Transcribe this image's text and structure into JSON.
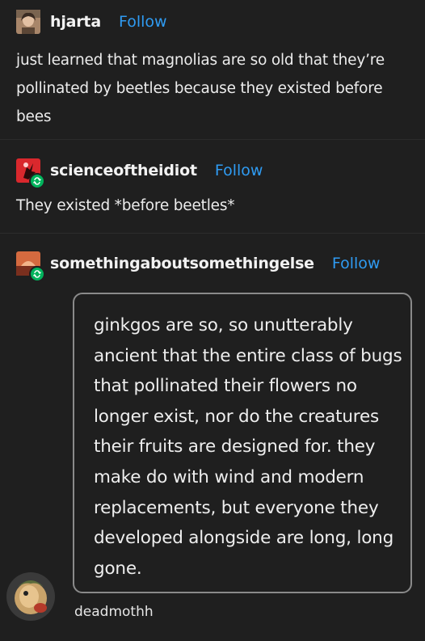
{
  "posts": [
    {
      "username": "hjarta",
      "follow_label": "Follow",
      "text": "just learned that magnolias are so old that they’re pollinated by beetles because they existed before bees"
    },
    {
      "username": "scienceoftheidiot",
      "follow_label": "Follow",
      "text": "They existed *before beetles*"
    },
    {
      "username": "somethingaboutsomethingelse",
      "follow_label": "Follow",
      "quote": "ginkgos are so, so unutterably ancient that the entire class of bugs that pollinated their flowers no longer exist, nor do the creatures their fruits are designed for. they make do with wind and modern replacements, but everyone they developed alongside are long, long gone."
    }
  ],
  "commenter": {
    "name": "deadmothh"
  },
  "colors": {
    "background": "#1f1f1f",
    "follow": "#2f9bf2",
    "reblog_badge": "#00b35c"
  },
  "icons": {
    "reblog": "reblog-icon"
  }
}
